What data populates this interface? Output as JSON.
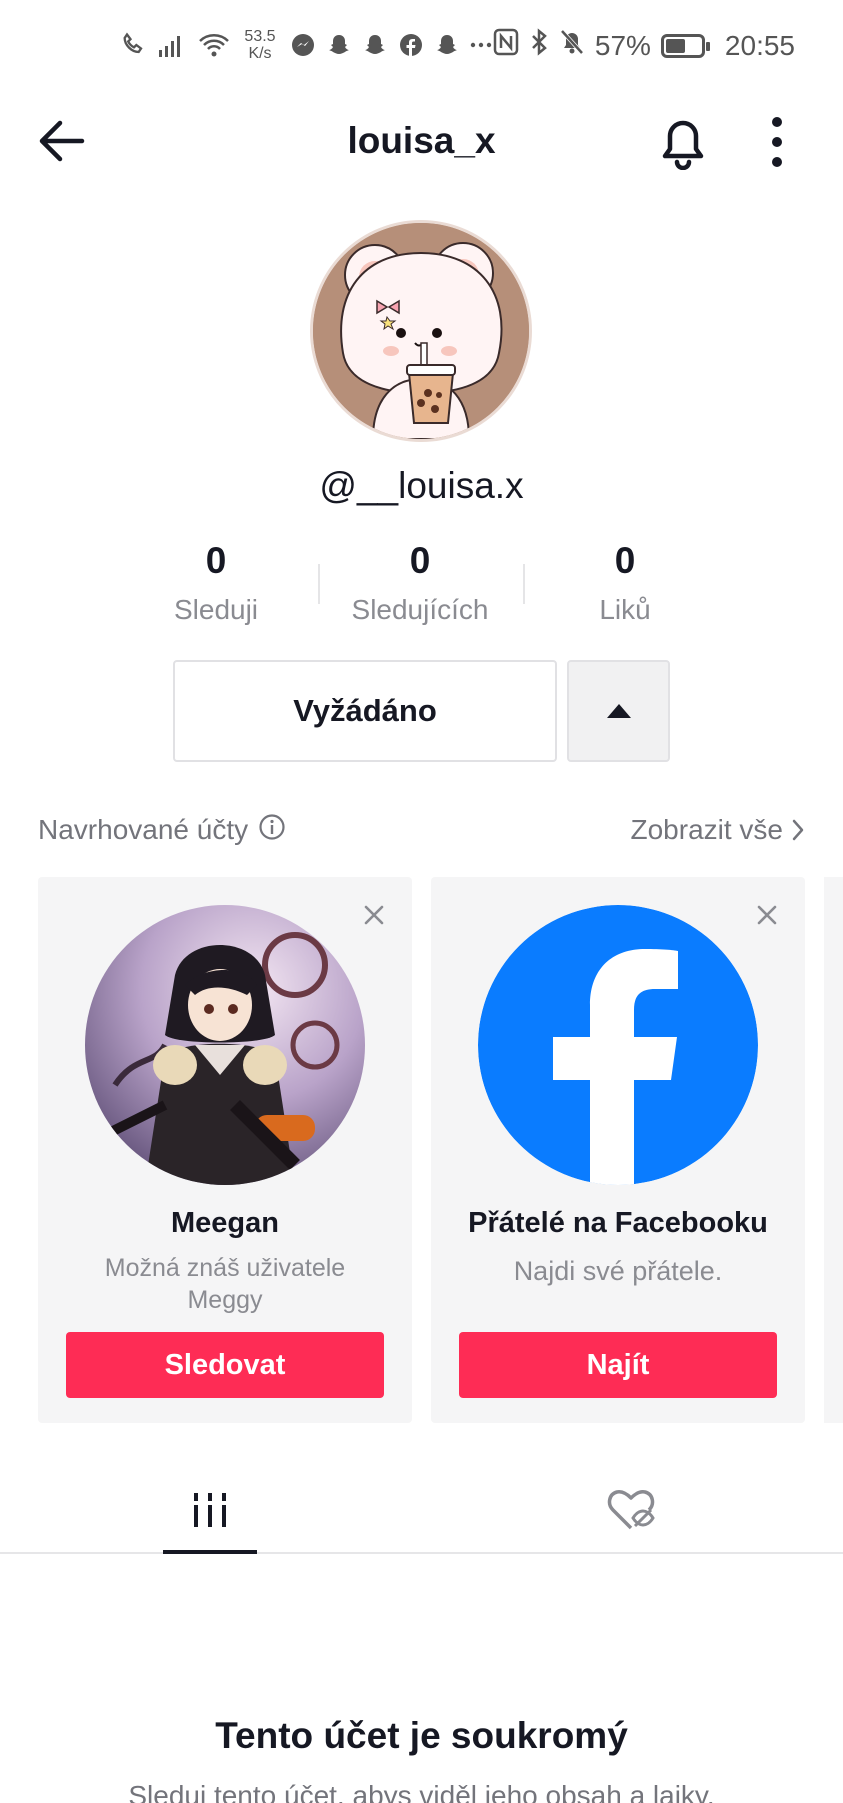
{
  "status_bar": {
    "speed_value": "53.5",
    "speed_unit": "K/s",
    "battery": "57%",
    "battery_level": 0.57,
    "time": "20:55"
  },
  "header": {
    "title": "louisa_x"
  },
  "profile": {
    "handle": "@__louisa.x"
  },
  "stats": [
    {
      "value": "0",
      "label": "Sleduji"
    },
    {
      "value": "0",
      "label": "Sledujících"
    },
    {
      "value": "0",
      "label": "Liků"
    }
  ],
  "actions": {
    "requested_label": "Vyžádáno"
  },
  "suggested": {
    "title": "Navrhované účty",
    "see_all": "Zobrazit vše",
    "cards": [
      {
        "name": "Meegan",
        "subtitle": "Možná znáš uživatele Meggy",
        "button": "Sledovat"
      },
      {
        "name": "Přátelé na Facebooku",
        "subtitle": "Najdi své přátele.",
        "button": "Najít"
      }
    ]
  },
  "private": {
    "title": "Tento účet je soukromý",
    "description": "Sleduj tento účet, abys viděl jeho obsah a lajky."
  },
  "colors": {
    "accent": "#fe2c55",
    "facebook": "#0a7cff"
  }
}
